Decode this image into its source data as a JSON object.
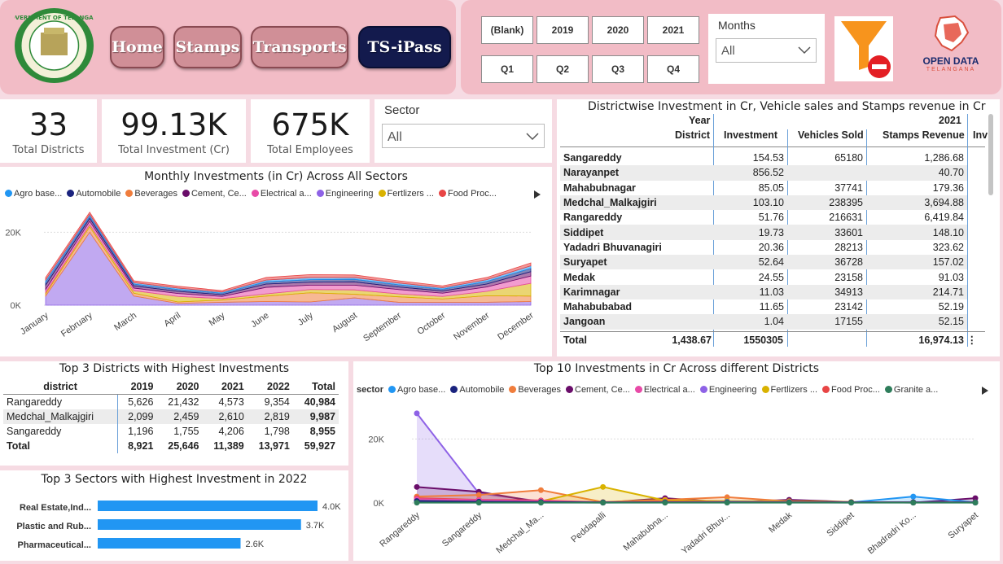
{
  "nav": {
    "logo_text": "GOVERNMENT OF TELANGANA",
    "buttons": [
      "Home",
      "Stamps",
      "Transports",
      "TS-iPass"
    ]
  },
  "filters": {
    "years": [
      "(Blank)",
      "2019",
      "2020",
      "2021"
    ],
    "quarters": [
      "Q1",
      "Q2",
      "Q3",
      "Q4"
    ],
    "months_label": "Months",
    "months_value": "All",
    "clear_filter_icon": "funnel-clear-icon",
    "brand_title": "OPEN DATA",
    "brand_sub": "TELANGANA"
  },
  "kpis": [
    {
      "value": "33",
      "label": "Total Districts"
    },
    {
      "value": "99.13K",
      "label": "Total Investment (Cr)"
    },
    {
      "value": "675K",
      "label": "Total Employees"
    }
  ],
  "sector_slicer": {
    "label": "Sector",
    "value": "All"
  },
  "colors": {
    "agro": "#2196f3",
    "automobile": "#1a237e",
    "beverages": "#f07d3c",
    "cement": "#6a0d6a",
    "electrical": "#e84aa7",
    "engineering": "#8e62e6",
    "fertilizers": "#d9b200",
    "food": "#e84545",
    "granite": "#2e7d5b"
  },
  "monthly_chart": {
    "title": "Monthly Investments (in Cr) Across All Sectors",
    "legend": [
      "Agro base...",
      "Automobile",
      "Beverages",
      "Cement, Ce...",
      "Electrical a...",
      "Engineering",
      "Fertlizers ...",
      "Food Proc..."
    ],
    "y_ticks": [
      "20K",
      "0K"
    ]
  },
  "district_table": {
    "title": "Districtwise Investment in Cr, Vehicle sales and Stamps revenue in Cr",
    "year_label": "Year",
    "year_value": "2021",
    "district_label": "District",
    "columns": [
      "Investment",
      "Vehicles Sold",
      "Stamps Revenue",
      "Inv"
    ],
    "rows": [
      [
        "Sangareddy",
        "154.53",
        "65180",
        "1,286.68"
      ],
      [
        "Narayanpet",
        "856.52",
        "",
        "40.70"
      ],
      [
        "Mahabubnagar",
        "85.05",
        "37741",
        "179.36"
      ],
      [
        "Medchal_Malkajgiri",
        "103.10",
        "238395",
        "3,694.88"
      ],
      [
        "Rangareddy",
        "51.76",
        "216631",
        "6,419.84"
      ],
      [
        "Siddipet",
        "19.73",
        "33601",
        "148.10"
      ],
      [
        "Yadadri Bhuvanagiri",
        "20.36",
        "28213",
        "323.62"
      ],
      [
        "Suryapet",
        "52.64",
        "36728",
        "157.02"
      ],
      [
        "Medak",
        "24.55",
        "23158",
        "91.03"
      ],
      [
        "Karimnagar",
        "11.03",
        "34913",
        "214.71"
      ],
      [
        "Mahabubabad",
        "11.65",
        "23142",
        "52.19"
      ],
      [
        "Jangoan",
        "1.04",
        "17155",
        "52.15"
      ]
    ],
    "total": [
      "Total",
      "1,438.67",
      "1550305",
      "16,974.13"
    ]
  },
  "top3_districts": {
    "title": "Top 3 Districts with Highest Investments",
    "columns": [
      "district",
      "2019",
      "2020",
      "2021",
      "2022",
      "Total"
    ],
    "rows": [
      [
        "Rangareddy",
        "5,626",
        "21,432",
        "4,573",
        "9,354",
        "40,984"
      ],
      [
        "Medchal_Malkajgiri",
        "2,099",
        "2,459",
        "2,610",
        "2,819",
        "9,987"
      ],
      [
        "Sangareddy",
        "1,196",
        "1,755",
        "4,206",
        "1,798",
        "8,955"
      ]
    ],
    "total": [
      "Total",
      "8,921",
      "25,646",
      "11,389",
      "13,971",
      "59,927"
    ]
  },
  "top3_sectors": {
    "title": "Top 3 Sectors with Highest Investment in 2022"
  },
  "top10_chart": {
    "title": "Top 10 Investments in Cr Across different Districts",
    "legend_title": "sector",
    "legend": [
      "Agro base...",
      "Automobile",
      "Beverages",
      "Cement, Ce...",
      "Electrical a...",
      "Engineering",
      "Fertlizers ...",
      "Food Proc...",
      "Granite a..."
    ],
    "y_ticks": [
      "20K",
      "0K"
    ]
  },
  "chart_data": [
    {
      "type": "area",
      "title": "Monthly Investments (in Cr) Across All Sectors",
      "categories": [
        "January",
        "February",
        "March",
        "April",
        "May",
        "June",
        "July",
        "August",
        "September",
        "October",
        "November",
        "December"
      ],
      "series": [
        {
          "name": "Engineering",
          "values": [
            2500,
            20000,
            2500,
            500,
            800,
            1000,
            900,
            2000,
            800,
            800,
            800,
            1000
          ]
        },
        {
          "name": "Beverages",
          "values": [
            600,
            1500,
            800,
            400,
            600,
            1500,
            2500,
            1000,
            1500,
            900,
            1800,
            1500
          ]
        },
        {
          "name": "Fertlizers ...",
          "values": [
            400,
            600,
            700,
            1500,
            400,
            600,
            900,
            1200,
            800,
            700,
            1200,
            3500
          ]
        },
        {
          "name": "Electrical a...",
          "values": [
            800,
            900,
            700,
            800,
            600,
            1800,
            1200,
            1300,
            1200,
            900,
            1200,
            2000
          ]
        },
        {
          "name": "Cement, Ce...",
          "values": [
            1200,
            800,
            600,
            600,
            500,
            900,
            800,
            900,
            700,
            600,
            800,
            1200
          ]
        },
        {
          "name": "Automobile",
          "values": [
            800,
            600,
            500,
            500,
            400,
            600,
            700,
            700,
            600,
            500,
            700,
            900
          ]
        },
        {
          "name": "Agro base...",
          "values": [
            600,
            500,
            400,
            400,
            300,
            500,
            600,
            500,
            500,
            400,
            500,
            700
          ]
        },
        {
          "name": "Food Proc...",
          "values": [
            700,
            600,
            500,
            500,
            400,
            700,
            800,
            700,
            600,
            500,
            600,
            800
          ]
        }
      ],
      "ylim": [
        0,
        25000
      ]
    },
    {
      "type": "bar",
      "title": "Top 3 Sectors with Highest Investment in 2022",
      "categories": [
        "Real Estate,Ind...",
        "Plastic and Rub...",
        "Pharmaceutical..."
      ],
      "values": [
        4000,
        3700,
        2600
      ],
      "value_labels": [
        "4.0K",
        "3.7K",
        "2.6K"
      ],
      "xlim": [
        0,
        4000
      ]
    },
    {
      "type": "line",
      "title": "Top 10 Investments in Cr Across different Districts",
      "categories": [
        "Rangareddy",
        "Sangareddy",
        "Medchal_Ma...",
        "Peddapalli",
        "Mahabubna...",
        "Yadadri Bhuv...",
        "Medak",
        "Siddipet",
        "Bhadradri Ko...",
        "Suryapet"
      ],
      "series": [
        {
          "name": "Engineering",
          "values": [
            28000,
            3000,
            500,
            100,
            200,
            300,
            200,
            100,
            300,
            100
          ]
        },
        {
          "name": "Cement, Ce...",
          "values": [
            5000,
            3500,
            200,
            100,
            1500,
            200,
            1000,
            300,
            100,
            1500
          ]
        },
        {
          "name": "Beverages",
          "values": [
            2000,
            2500,
            4000,
            300,
            1000,
            1800,
            500,
            300,
            200,
            200
          ]
        },
        {
          "name": "Fertlizers ...",
          "values": [
            1000,
            800,
            500,
            5000,
            800,
            600,
            500,
            300,
            200,
            200
          ]
        },
        {
          "name": "Agro base...",
          "values": [
            800,
            500,
            300,
            200,
            300,
            400,
            300,
            200,
            2000,
            200
          ]
        },
        {
          "name": "Food Proc...",
          "values": [
            1500,
            1000,
            800,
            200,
            400,
            300,
            300,
            200,
            200,
            200
          ]
        },
        {
          "name": "Electrical a...",
          "values": [
            1200,
            900,
            600,
            200,
            300,
            300,
            300,
            200,
            200,
            200
          ]
        },
        {
          "name": "Automobile",
          "values": [
            600,
            400,
            300,
            200,
            200,
            200,
            200,
            200,
            200,
            200
          ]
        },
        {
          "name": "Granite a...",
          "values": [
            100,
            100,
            100,
            100,
            100,
            100,
            100,
            100,
            100,
            100
          ]
        }
      ],
      "ylim": [
        0,
        30000
      ]
    }
  ]
}
